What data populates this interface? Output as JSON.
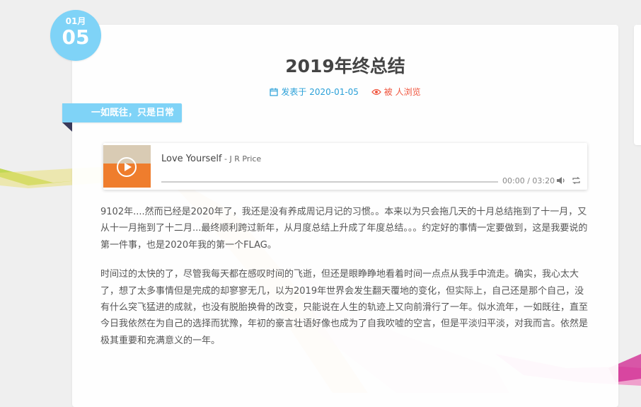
{
  "date": {
    "month": "01月",
    "day": "05"
  },
  "post": {
    "title": "2019年终总结",
    "published": "发表于 2020-01-05",
    "views": "被 人浏览",
    "tag": "一如既往，只是日常"
  },
  "player": {
    "song": "Love Yourself",
    "artist": " - J R Price",
    "time": "00:00 / 03:20",
    "progress": 0
  },
  "content": {
    "p1": "9102年....然而已经是2020年了，我还是没有养成周记月记的习惯。。本来以为只会拖几天的十月总结拖到了十一月，又从十一月拖到了十二月...最终顺利跨过新年，从月度总结上升成了年度总结。。。约定好的事情一定要做到，这是我要说的第一件事，也是2020年我的第一个FLAG。",
    "p2": "时间过的太快的了，尽管我每天都在感叹时间的飞逝，但还是眼睁睁地看着时间一点点从我手中流走。确实，我心太大了，想了太多事情但是完成的却寥寥无几，以为2019年世界会发生翻天覆地的变化，但实际上，自己还是那个自己，没有什么突飞猛进的成就，也没有脱胎换骨的改变，只能说在人生的轨迹上又向前滑行了一年。似水流年，一如既往，直至今日我依然在为自己的选择而犹豫，年初的豪言壮语好像也成为了自我吹嘘的空言，但是平淡归平淡，对我而言。依然是极其重要和充满意义的一年。"
  },
  "colors": {
    "accent": "#7fd3f7",
    "link": "#2aa0d8",
    "views": "#f0553e",
    "cover": "#ef7d2d"
  },
  "icons": {
    "calendar": "calendar-icon",
    "eye": "eye-icon",
    "play": "play-icon",
    "volume": "volume-icon",
    "loop": "loop-icon"
  }
}
